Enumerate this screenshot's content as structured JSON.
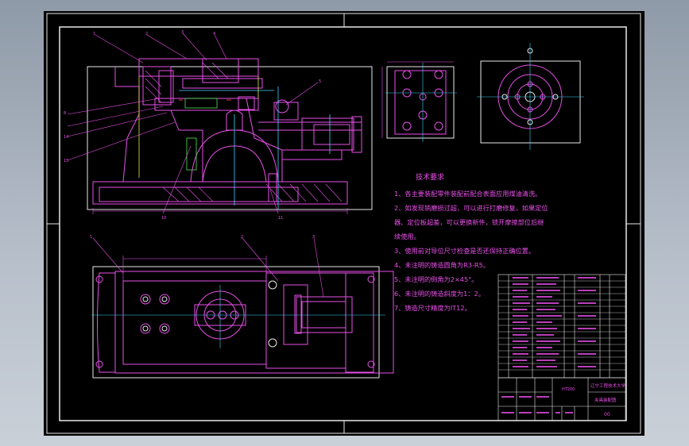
{
  "colors": {
    "background": "#000000",
    "line_white": "#e8e8e8",
    "line_magenta": "#e84fe8",
    "line_cyan": "#3fd3ff",
    "line_yellow": "#e8e84f",
    "line_green": "#4fe84f",
    "line_red": "#ff4040"
  },
  "notes": {
    "title": "技术要求",
    "items": [
      "1、各主要装配零件装配前配合表面应用煤油清洗。",
      "2、如发现销磨损过超，可以进行打磨修复，如果定位",
      "器、定位板超差，可以更换新件，锁开摩擦部位后继",
      "续使用。",
      "3、使用前对导位尺寸检查是否还保持正确位置。",
      "4、未注明的铸造圆角为R3-R5。",
      "5、未注明的倒角为2×45°。",
      "6、未注明的铸造斜度为1：2。",
      "7、铸造尺寸精度为IT12。"
    ]
  },
  "title_block": {
    "school": "辽宁工程技术大学",
    "drawing_name": "夹具装配图",
    "code": "00",
    "material": "HT200"
  }
}
